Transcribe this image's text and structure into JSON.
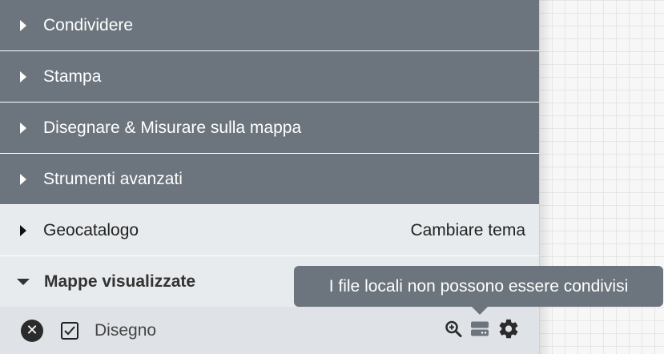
{
  "menu": {
    "dark_items": [
      {
        "label": "Condividere"
      },
      {
        "label": "Stampa"
      },
      {
        "label": "Disegnare & Misurare sulla mappa"
      },
      {
        "label": "Strumenti avanzati"
      }
    ],
    "geocatalog": {
      "label": "Geocatalogo",
      "theme_link": "Cambiare tema"
    },
    "displayed_maps": {
      "label": "Mappe visualizzate"
    }
  },
  "layer": {
    "label": "Disegno",
    "checked": true,
    "icons": [
      "remove-icon",
      "checkbox-checked-icon",
      "zoom-in-icon",
      "storage-icon",
      "gear-icon"
    ]
  },
  "tooltip": {
    "text": "I file locali non possono essere condivisi"
  },
  "colors": {
    "panel_dark": "#6c757d",
    "panel_light": "#e8ebee",
    "tooltip": "#6c757d"
  }
}
